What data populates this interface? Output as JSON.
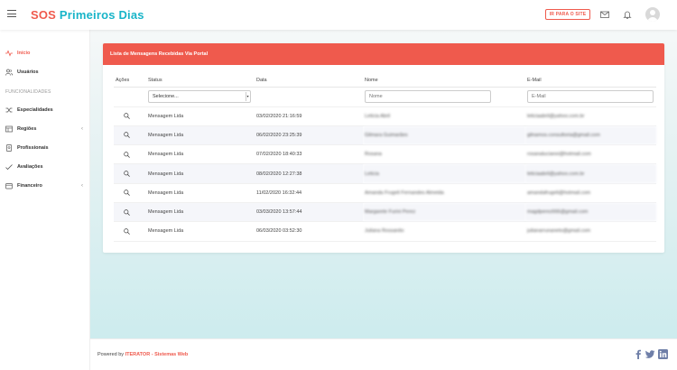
{
  "brand": {
    "sos": "SOS",
    "name": "Primeiros Dias"
  },
  "topbar": {
    "site_button": "IR PARA O SITE"
  },
  "sidebar": {
    "items": [
      {
        "label": "Início",
        "icon": "pulse-icon",
        "active": true
      },
      {
        "label": "Usuários",
        "icon": "users-icon"
      }
    ],
    "section_label": "FUNCIONALIDADES",
    "features": [
      {
        "label": "Especialidades",
        "icon": "shuffle-icon"
      },
      {
        "label": "Regiões",
        "icon": "map-icon",
        "expandable": true
      },
      {
        "label": "Profissionais",
        "icon": "id-badge-icon"
      },
      {
        "label": "Avaliações",
        "icon": "check-icon"
      },
      {
        "label": "Financeiro",
        "icon": "wallet-icon",
        "expandable": true
      }
    ]
  },
  "card": {
    "title": "Lista de Mensagens Recebidas Via Portal"
  },
  "table": {
    "headers": {
      "acoes": "Ações",
      "status": "Status",
      "data": "Data",
      "nome": "Nome",
      "email": "E-Mail"
    },
    "filters": {
      "status_selected": "Selecione...",
      "nome_placeholder": "Nome",
      "email_placeholder": "E-Mail"
    },
    "rows": [
      {
        "status": "Mensagem Lida",
        "data": "03/02/2020 21:16:59",
        "nome": "Leticia Abril",
        "email": "leticiaabril@yahoo.com.br"
      },
      {
        "status": "Mensagem Lida",
        "data": "06/02/2020 23:25:39",
        "nome": "Gilmara Guimarães",
        "email": "gilnamos.consultoria@gmail.com"
      },
      {
        "status": "Mensagem Lida",
        "data": "07/02/2020 18:40:33",
        "nome": "Rosana",
        "email": "rosanalucianoi@hotmail.com"
      },
      {
        "status": "Mensagem Lida",
        "data": "08/02/2020 12:27:38",
        "nome": "Leticia",
        "email": "leticiaabril@yahoo.com.br"
      },
      {
        "status": "Mensagem Lida",
        "data": "11/02/2020 16:32:44",
        "nome": "Amanda Frugeli Fernandes Almeida",
        "email": "amandafrugeli@hotmail.com"
      },
      {
        "status": "Mensagem Lida",
        "data": "03/03/2020 13:57:44",
        "nome": "Margarete Furini Perez",
        "email": "magdperez666@gmail.com"
      },
      {
        "status": "Mensagem Lida",
        "data": "06/03/2020 03:52:30",
        "nome": "Juliana Rossanito",
        "email": "julianarrunaneto@gmail.com"
      }
    ]
  },
  "footer": {
    "prefix": "Powered by ",
    "credit": "ITERATOR - Sistemas Web"
  },
  "colors": {
    "accent": "#ef5a4d",
    "brand": "#18b4c8"
  }
}
